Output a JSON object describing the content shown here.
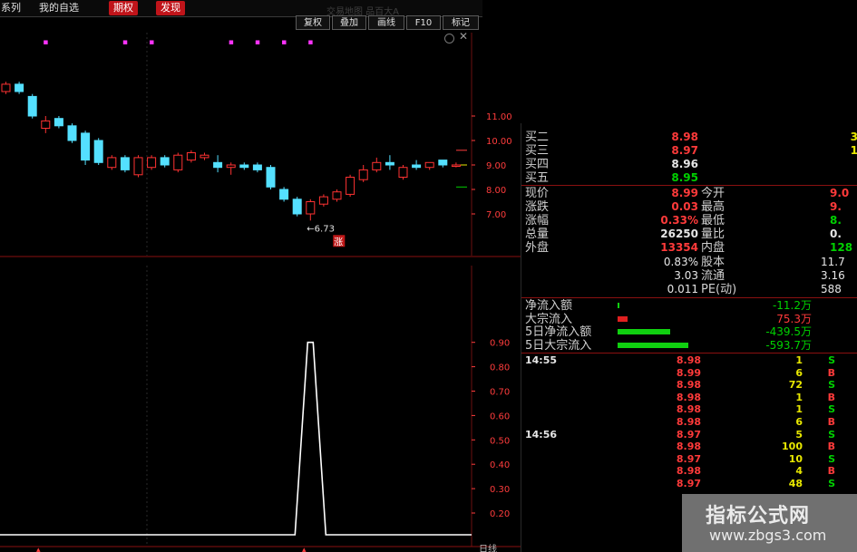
{
  "tabs": [
    {
      "label": "系列",
      "style": "plain"
    },
    {
      "label": "我的自选",
      "style": "plain"
    },
    {
      "label": "期权",
      "style": "red"
    },
    {
      "label": "发现",
      "style": "red"
    }
  ],
  "toolbar": {
    "faded_title": "交易地图  品百大A",
    "buttons": [
      "复权",
      "叠加",
      "画线",
      "F10",
      "标记"
    ]
  },
  "price_axis": {
    "labels": [
      "11.00",
      "10.00",
      "9.00",
      "8.00",
      "7.00"
    ],
    "values": [
      11,
      10,
      9,
      8,
      7
    ]
  },
  "kline": {
    "low_marker_text": "←6.73",
    "zhang_label": "涨",
    "candles": [
      {
        "o": 12.0,
        "c": 12.3,
        "h": 12.4,
        "l": 11.9
      },
      {
        "o": 12.3,
        "c": 12.0,
        "h": 12.4,
        "l": 11.9
      },
      {
        "o": 11.8,
        "c": 11.0,
        "h": 11.9,
        "l": 10.9
      },
      {
        "o": 10.5,
        "c": 10.8,
        "h": 11.0,
        "l": 10.3
      },
      {
        "o": 10.9,
        "c": 10.6,
        "h": 11.0,
        "l": 10.5
      },
      {
        "o": 10.6,
        "c": 10.0,
        "h": 10.7,
        "l": 9.9
      },
      {
        "o": 10.3,
        "c": 9.2,
        "h": 10.4,
        "l": 9.0
      },
      {
        "o": 10.0,
        "c": 9.1,
        "h": 10.1,
        "l": 9.0
      },
      {
        "o": 8.9,
        "c": 9.3,
        "h": 9.4,
        "l": 8.8
      },
      {
        "o": 9.3,
        "c": 8.8,
        "h": 9.4,
        "l": 8.7
      },
      {
        "o": 8.6,
        "c": 9.3,
        "h": 9.4,
        "l": 8.5
      },
      {
        "o": 8.9,
        "c": 9.3,
        "h": 9.4,
        "l": 8.8
      },
      {
        "o": 9.3,
        "c": 9.0,
        "h": 9.4,
        "l": 8.9
      },
      {
        "o": 8.8,
        "c": 9.4,
        "h": 9.5,
        "l": 8.7
      },
      {
        "o": 9.2,
        "c": 9.5,
        "h": 9.6,
        "l": 9.1
      },
      {
        "o": 9.3,
        "c": 9.4,
        "h": 9.5,
        "l": 9.2
      },
      {
        "o": 9.1,
        "c": 8.9,
        "h": 9.4,
        "l": 8.7
      },
      {
        "o": 8.9,
        "c": 9.0,
        "h": 9.1,
        "l": 8.6
      },
      {
        "o": 9.0,
        "c": 8.9,
        "h": 9.1,
        "l": 8.8
      },
      {
        "o": 9.0,
        "c": 8.8,
        "h": 9.1,
        "l": 8.7
      },
      {
        "o": 8.9,
        "c": 8.1,
        "h": 9.0,
        "l": 8.0
      },
      {
        "o": 8.0,
        "c": 7.6,
        "h": 8.1,
        "l": 7.5
      },
      {
        "o": 7.6,
        "c": 7.0,
        "h": 7.7,
        "l": 6.9
      },
      {
        "o": 7.0,
        "c": 7.5,
        "h": 7.6,
        "l": 6.73
      },
      {
        "o": 7.4,
        "c": 7.7,
        "h": 7.8,
        "l": 7.3
      },
      {
        "o": 7.6,
        "c": 7.9,
        "h": 8.0,
        "l": 7.5
      },
      {
        "o": 7.8,
        "c": 8.5,
        "h": 8.6,
        "l": 7.7
      },
      {
        "o": 8.4,
        "c": 8.8,
        "h": 9.0,
        "l": 8.3
      },
      {
        "o": 8.8,
        "c": 9.1,
        "h": 9.3,
        "l": 8.7
      },
      {
        "o": 9.1,
        "c": 9.0,
        "h": 9.4,
        "l": 8.8
      },
      {
        "o": 8.5,
        "c": 8.9,
        "h": 9.0,
        "l": 8.4
      },
      {
        "o": 9.0,
        "c": 8.9,
        "h": 9.2,
        "l": 8.8
      },
      {
        "o": 8.9,
        "c": 9.1,
        "h": 9.1,
        "l": 8.8
      },
      {
        "o": 9.2,
        "c": 9.0,
        "h": 9.2,
        "l": 8.9
      },
      {
        "o": 9.0,
        "c": 9.0,
        "h": 9.1,
        "l": 8.9
      }
    ],
    "magenta_marks_candles": [
      3,
      9,
      11,
      17,
      19,
      21,
      23
    ]
  },
  "indicator_axis": {
    "labels": [
      "0.90",
      "0.80",
      "0.70",
      "0.60",
      "0.50",
      "0.40",
      "0.30",
      "0.20"
    ],
    "values": [
      0.9,
      0.8,
      0.7,
      0.6,
      0.5,
      0.4,
      0.3,
      0.2
    ]
  },
  "indicator": {
    "peak_value": 0.9,
    "peak_candle": 23
  },
  "quote": {
    "bids": [
      {
        "label": "买二",
        "price": "8.98",
        "price_color": "red",
        "vol": "3"
      },
      {
        "label": "买三",
        "price": "8.97",
        "price_color": "red",
        "vol": "1"
      },
      {
        "label": "买四",
        "price": "8.96",
        "price_color": "white",
        "vol": ""
      },
      {
        "label": "买五",
        "price": "8.95",
        "price_color": "green",
        "vol": ""
      }
    ],
    "stats": [
      {
        "l1": "现价",
        "v1": "8.99",
        "c1": "red",
        "l2": "今开",
        "v2": "9.0",
        "c2": "red"
      },
      {
        "l1": "涨跌",
        "v1": "0.03",
        "c1": "red",
        "l2": "最高",
        "v2": "9.",
        "c2": "red"
      },
      {
        "l1": "涨幅",
        "v1": "0.33%",
        "c1": "red",
        "l2": "最低",
        "v2": "8.",
        "c2": "green"
      },
      {
        "l1": "总量",
        "v1": "26250",
        "c1": "white",
        "l2": "量比",
        "v2": "0.",
        "c2": "white"
      },
      {
        "l1": "外盘",
        "v1": "13354",
        "c1": "red",
        "l2": "内盘",
        "v2": "128",
        "c2": "green"
      }
    ],
    "extra": [
      {
        "v1": "0.83%",
        "l2": "股本",
        "v2": "11.7"
      },
      {
        "v1": "3.03",
        "l2": "流通",
        "v2": "3.16"
      },
      {
        "v1": "0.011",
        "l2": "PE(动)",
        "v2": "588"
      }
    ],
    "flows": [
      {
        "label": "净流入额",
        "bar": 0.02,
        "value": "-11.2万",
        "color": "green"
      },
      {
        "label": "大宗流入",
        "bar": 0.14,
        "value": "75.3万",
        "color": "red"
      },
      {
        "label": "5日净流入额",
        "bar": 0.72,
        "value": "-439.5万",
        "color": "green"
      },
      {
        "label": "5日大宗流入",
        "bar": 0.98,
        "value": "-593.7万",
        "color": "green"
      }
    ]
  },
  "ticks": [
    {
      "time": "14:55",
      "price": "8.98",
      "vol": "1",
      "bs": "S"
    },
    {
      "time": "",
      "price": "8.99",
      "vol": "6",
      "bs": "B"
    },
    {
      "time": "",
      "price": "8.98",
      "vol": "72",
      "bs": "S"
    },
    {
      "time": "",
      "price": "8.98",
      "vol": "1",
      "bs": "B"
    },
    {
      "time": "",
      "price": "8.98",
      "vol": "1",
      "bs": "S"
    },
    {
      "time": "",
      "price": "8.98",
      "vol": "6",
      "bs": "B"
    },
    {
      "time": "14:56",
      "price": "8.97",
      "vol": "5",
      "bs": "S"
    },
    {
      "time": "",
      "price": "8.98",
      "vol": "100",
      "bs": "B"
    },
    {
      "time": "",
      "price": "8.97",
      "vol": "10",
      "bs": "S"
    },
    {
      "time": "",
      "price": "8.98",
      "vol": "4",
      "bs": "B"
    },
    {
      "time": "",
      "price": "8.97",
      "vol": "48",
      "bs": "S"
    }
  ],
  "badge": {
    "title": "指标公式网",
    "url": "www.zbgs3.com"
  },
  "bottom_label": "日线",
  "colors": {
    "up": "#ff3232",
    "down": "#54e0ff",
    "mark": "#ff33ff",
    "axis_red": "#ff3c3c"
  }
}
